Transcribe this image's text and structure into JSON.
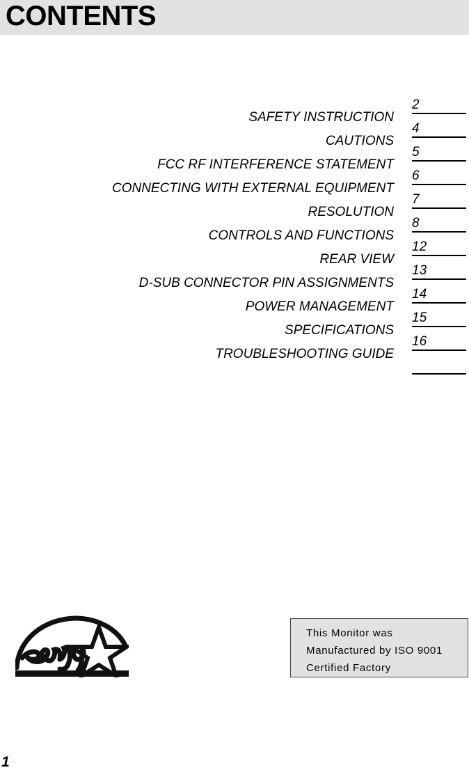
{
  "header": {
    "title": "CONTENTS",
    "background_color": "#e2e2e2"
  },
  "toc": {
    "entries": [
      {
        "label": "SAFETY INSTRUCTION",
        "page": "2"
      },
      {
        "label": "CAUTIONS",
        "page": "4"
      },
      {
        "label": "FCC RF INTERFERENCE STATEMENT",
        "page": "5"
      },
      {
        "label": "CONNECTING WITH EXTERNAL EQUIPMENT",
        "page": "6"
      },
      {
        "label": "RESOLUTION",
        "page": "7"
      },
      {
        "label": "CONTROLS AND FUNCTIONS",
        "page": "8"
      },
      {
        "label": "REAR VIEW",
        "page": "12"
      },
      {
        "label": "D-SUB CONNECTOR PIN ASSIGNMENTS",
        "page": "13"
      },
      {
        "label": "POWER MANAGEMENT",
        "page": "14"
      },
      {
        "label": "SPECIFICATIONS",
        "page": "15"
      },
      {
        "label": "TROUBLESHOOTING GUIDE",
        "page": "16"
      },
      {
        "label": "",
        "page": ""
      }
    ]
  },
  "logo": {
    "name": "energy-star-logo",
    "text": "energy"
  },
  "iso_notice": {
    "line1": "This Monitor was",
    "line2": "Manufactured by ISO 9001",
    "line3": "Certified Factory",
    "background_color": "#e2e2e2",
    "border_color": "#444444"
  },
  "footer": {
    "page_number": "1"
  }
}
